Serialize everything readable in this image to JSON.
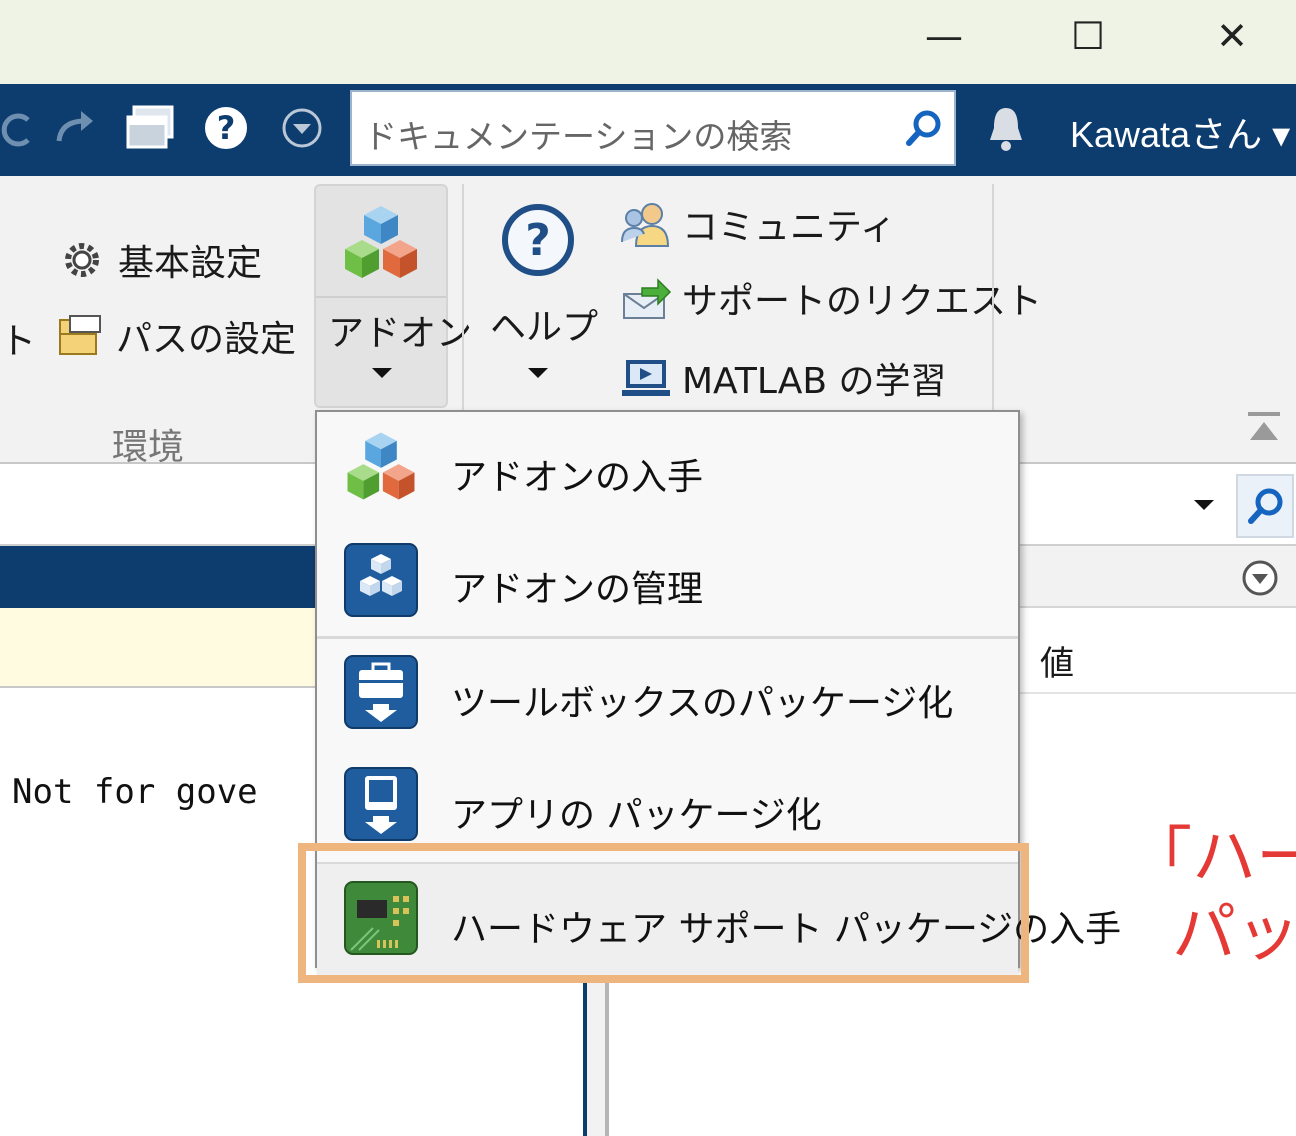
{
  "window": {
    "minimize_glyph": "—",
    "maximize_glyph": "☐",
    "close_glyph": "✕"
  },
  "toolbar": {
    "search_placeholder": "ドキュメンテーションの検索",
    "user_label": "Kawataさん ▾",
    "help_glyph": "?"
  },
  "ribbon": {
    "partial_left_label": "ト",
    "preferences_label": "基本設定",
    "set_path_label": "パスの設定",
    "environment_section_label": "環境",
    "addons_button_label": "アドオン",
    "help_button_label": "ヘルプ",
    "community_label": "コミュニティ",
    "support_request_label": "サポートのリクエスト",
    "learn_matlab_label": "MATLAB の学習"
  },
  "addons_menu": {
    "items": [
      {
        "label": "アドオンの入手",
        "icon": "addons-cube-icon"
      },
      {
        "label": "アドオンの管理",
        "icon": "manage-addons-icon"
      },
      {
        "label": "ツールボックスのパッケージ化",
        "icon": "package-toolbox-icon"
      },
      {
        "label": "アプリの パッケージ化",
        "icon": "package-app-icon"
      },
      {
        "label": "ハードウェア サポート パッケージの入手",
        "icon": "hardware-board-icon"
      }
    ]
  },
  "workspace": {
    "value_column_header": "値"
  },
  "command_window": {
    "text": "Not for gove"
  },
  "callout": {
    "line1": "「ハー",
    "line2": "パッ"
  },
  "colors": {
    "accent_dark_blue": "#0d3c6e",
    "highlight_orange": "#efb57f",
    "callout_red": "#e53935"
  }
}
